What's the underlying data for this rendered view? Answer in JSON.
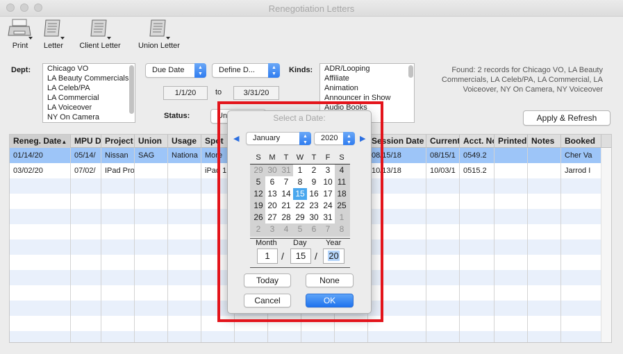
{
  "window": {
    "title": "Renegotiation Letters"
  },
  "toolbar": [
    {
      "label": "Print",
      "icon": "printer-icon"
    },
    {
      "label": "Letter",
      "icon": "letter-icon"
    },
    {
      "label": "Client Letter",
      "icon": "client-letter-icon"
    },
    {
      "label": "Union Letter",
      "icon": "union-letter-icon"
    }
  ],
  "filters": {
    "dept_label": "Dept:",
    "dept_items": [
      "Chicago VO",
      "LA Beauty Commercials",
      "LA Celeb/PA",
      "LA Commercial",
      "LA Voiceover",
      "NY On Camera"
    ],
    "date_type": "Due Date",
    "date_range": "Define D...",
    "from_date": "1/1/20",
    "to_label": "to",
    "to_date": "3/31/20",
    "status_label": "Status:",
    "status_value": "Un",
    "kinds_label": "Kinds:",
    "kinds_items": [
      "ADR/Looping",
      "Affiliate",
      "Animation",
      "Announcer in Show",
      "Audio Books"
    ]
  },
  "found": {
    "text": "Found: 2 records for Chicago VO, LA Beauty Commercials, LA Celeb/PA, LA Commercial, LA Voiceover, NY On Camera, NY Voiceover"
  },
  "apply_button": "Apply & Refresh",
  "table": {
    "columns": [
      "Reneg. Date",
      "MPU Da",
      "Project",
      "Union",
      "Usage",
      "Spot",
      "",
      "",
      "",
      "",
      "Session Date",
      "Current",
      "Acct. No",
      "Printed",
      "Notes",
      "Booked"
    ],
    "rows": [
      [
        "01/14/20",
        "05/14/",
        "Nissan",
        "SAG",
        "Nationa",
        "More",
        "",
        "",
        "",
        "",
        "08/15/18",
        "08/15/1",
        "0549.2",
        "",
        "",
        "Cher Va"
      ],
      [
        "03/02/20",
        "07/02/",
        "IPad Pro",
        "",
        "",
        "iPad 1",
        "",
        "",
        "",
        "",
        "10/13/18",
        "10/03/1",
        "0515.2",
        "",
        "",
        "Jarrod I"
      ]
    ]
  },
  "date_dialog": {
    "title": "Select a Date:",
    "month": "January",
    "year": "2020",
    "weekdays": [
      "S",
      "M",
      "T",
      "W",
      "T",
      "F",
      "S"
    ],
    "weeks": [
      [
        "29",
        "30",
        "31",
        "1",
        "2",
        "3",
        "4"
      ],
      [
        "5",
        "6",
        "7",
        "8",
        "9",
        "10",
        "11"
      ],
      [
        "12",
        "13",
        "14",
        "15",
        "16",
        "17",
        "18"
      ],
      [
        "19",
        "20",
        "21",
        "22",
        "23",
        "24",
        "25"
      ],
      [
        "26",
        "27",
        "28",
        "29",
        "30",
        "31",
        "1"
      ],
      [
        "2",
        "3",
        "4",
        "5",
        "6",
        "7",
        "8"
      ]
    ],
    "selected_day": "15",
    "month_label": "Month",
    "day_label": "Day",
    "year_label": "Year",
    "month_value": "1",
    "day_value": "15",
    "year_value": "20",
    "slash": "/",
    "today_button": "Today",
    "none_button": "None",
    "cancel_button": "Cancel",
    "ok_button": "OK"
  },
  "colors": {
    "accent": "#2f7cf0",
    "selection": "#9dc5f8",
    "highlight_box": "#e3141b"
  }
}
